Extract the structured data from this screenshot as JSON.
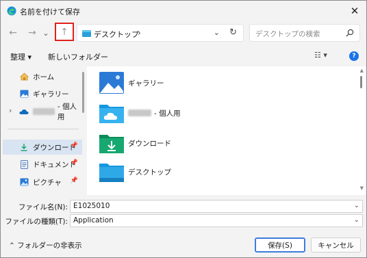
{
  "window": {
    "title": "名前を付けて保存",
    "close_glyph": "✕"
  },
  "nav": {
    "back_glyph": "←",
    "forward_glyph": "→",
    "recent_glyph": "⌄",
    "up_glyph": "↑",
    "address_path": "デスクトップ",
    "address_sep": "›",
    "address_dropdown_glyph": "⌄",
    "refresh_glyph": "↻",
    "search_placeholder": "デスクトップの検索"
  },
  "commands": {
    "organize": "整理 ▾",
    "new_folder": "新しいフォルダー",
    "view_glyph": "☷ ▾",
    "help_glyph": "?"
  },
  "sidebar": {
    "items": [
      {
        "label": "ホーム",
        "icon": "home-icon"
      },
      {
        "label": "ギャラリー",
        "icon": "gallery-icon"
      },
      {
        "label": "- 個人用",
        "icon": "onedrive-icon",
        "chevron": "›"
      },
      {
        "label": "ダウンロード",
        "icon": "download-icon",
        "pinned": true,
        "selected": true
      },
      {
        "label": "ドキュメント",
        "icon": "document-icon",
        "pinned": true
      },
      {
        "label": "ピクチャ",
        "icon": "pictures-icon",
        "pinned": true
      }
    ],
    "pin_glyph": "📌"
  },
  "files": [
    {
      "label": "ギャラリー",
      "icon": "gallery-folder-icon"
    },
    {
      "label": "- 個人用",
      "icon": "onedrive-folder-icon"
    },
    {
      "label": "ダウンロード",
      "icon": "download-folder-icon"
    },
    {
      "label": "デスクトップ",
      "icon": "desktop-folder-icon"
    }
  ],
  "form": {
    "filename_label": "ファイル名(N):",
    "filename_value": "E1025010",
    "filetype_label": "ファイルの種類(T):",
    "filetype_value": "Application",
    "dropdown_glyph": "⌄"
  },
  "footer": {
    "toggle_folders": "⌃  フォルダーの非表示",
    "save": "保存(S)",
    "cancel": "キャンセル"
  },
  "colors": {
    "highlight_border": "#e0201b",
    "selection": "#d9e4f2",
    "accent": "#3b7ddd"
  }
}
